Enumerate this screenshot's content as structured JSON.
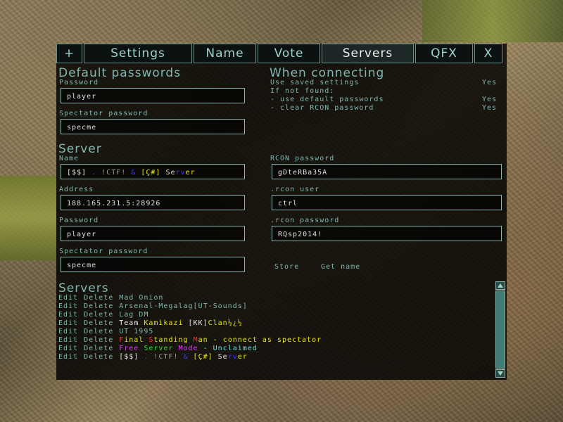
{
  "tabs": {
    "plus": "+",
    "settings": "Settings",
    "name": "Name",
    "vote": "Vote",
    "servers": "Servers",
    "qfx": "QFX",
    "close": "X"
  },
  "default_passwords": {
    "heading": "Default passwords",
    "password_label": "Password",
    "password_value": "player",
    "spectator_label": "Spectator password",
    "spectator_value": "specme"
  },
  "when_connecting": {
    "heading": "When connecting",
    "use_saved_label": "Use saved settings",
    "use_saved_value": "Yes",
    "if_not_found": "If not found:",
    "use_default_label": "- use default passwords",
    "use_default_value": "Yes",
    "clear_rcon_label": "- clear RCON password",
    "clear_rcon_value": "Yes"
  },
  "server": {
    "heading": "Server",
    "name_label": "Name",
    "name_value": {
      "p1": "[$$] ",
      "p2": ". ",
      "p3": "!CTF! ",
      "p4": "& ",
      "p5": "[Ç#] ",
      "p6": "Se",
      "p7": "r",
      "p8": "v",
      "p9": "er"
    },
    "address_label": "Address",
    "address_value": "188.165.231.5:28926",
    "password_label": "Password",
    "password_value": "player",
    "spectator_label": "Spectator password",
    "spectator_value": "specme",
    "rcon_password_label": "RCON password",
    "rcon_password_value": "gDteRBa35A",
    "rcon_user_label": ".rcon user",
    "rcon_user_value": "ctrl",
    "rcon_pw_label": ".rcon password",
    "rcon_pw_value": "RQsp2014!",
    "store_label": "Store",
    "get_name_label": "Get name"
  },
  "servers_list": {
    "heading": "Servers",
    "edit_label": "Edit",
    "delete_label": "Delete",
    "items": [
      {
        "name": "Mad Onion"
      },
      {
        "name": "Arsenal-Megalag[UT-Sounds]"
      },
      {
        "name": "Lag DM"
      },
      {
        "name": "Team Kamikazi [KK]Clan½¿½"
      },
      {
        "name": "UT 1995"
      },
      {
        "name": "Final Standing Man - connect as spectator"
      },
      {
        "name": "Free Server Mode - Unclaimed"
      },
      {
        "name": "[$$] . !CTF! & [Ç#] Server"
      }
    ],
    "colored": {
      "team": "Team ",
      "kamikazi": "Kamikazi ",
      "kk": "[KK]",
      "clan": "Clan½¿½",
      "f1": "F",
      "f2": "inal ",
      "f3": "S",
      "f4": "tanding ",
      "f5": "M",
      "f6": "an - connect as spectator",
      "fr1": "Free ",
      "fr2": "Server ",
      "fr3": "Mode ",
      "fr4": "- Unclaimed"
    }
  },
  "colors": {
    "accent": "#7fb8b0",
    "border": "#8fb5b0",
    "panel_bg": "#000000"
  }
}
